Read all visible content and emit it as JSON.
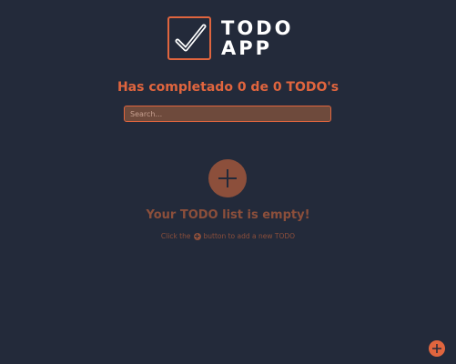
{
  "logo": {
    "icon": "check-icon",
    "line1": "TODO",
    "line2": "APP"
  },
  "header": {
    "title": "Has completado 0 de 0 TODO's"
  },
  "search": {
    "placeholder": "Search...",
    "value": ""
  },
  "empty_state": {
    "add_icon": "plus-icon",
    "title": "Your TODO list is empty!",
    "hint_before": "Click the",
    "hint_after": "button to add a new TODO"
  },
  "fab": {
    "icon": "plus-icon"
  },
  "colors": {
    "background": "#232a3a",
    "accent": "#e0653e",
    "muted_accent": "#8c4f3b"
  }
}
